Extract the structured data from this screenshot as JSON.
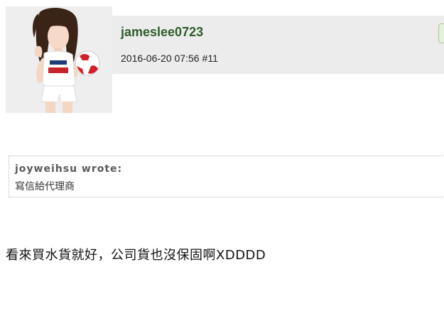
{
  "post": {
    "username": "jameslee0723",
    "date": "2016-06-20 07:56",
    "post_number": "#11",
    "body": "看來買水貨就好，公司貨也沒保固啊XDDDD"
  },
  "quote": {
    "author": "joyweihsu wrote:",
    "text": "寫信給代理商"
  },
  "colors": {
    "header_bg": "#ececec",
    "username": "#2e5e2b",
    "action_tab": "#e6f1dc"
  }
}
